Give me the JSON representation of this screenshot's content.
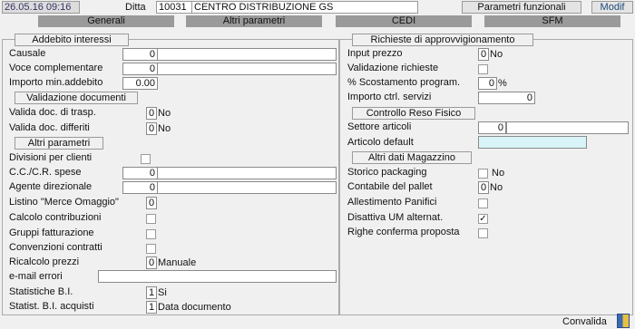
{
  "header": {
    "datetime": "26.05.16 09:16",
    "ditta_label": "Ditta",
    "ditta_code": "10031",
    "ditta_name": "CENTRO DISTRIBUZIONE GS",
    "parametri_button": "Parametri funzionali",
    "modif_label": "Modif"
  },
  "tabs": [
    "Generali",
    "Altri parametri",
    "CEDI",
    "SFM"
  ],
  "left": {
    "addebito": {
      "title": "Addebito interessi",
      "causale_label": "Causale",
      "causale_value": "0",
      "voce_label": "Voce complementare",
      "voce_value": "0",
      "importo_label": "Importo min.addebito",
      "importo_value": "0.00"
    },
    "validazione": {
      "title": "Validazione documenti",
      "trasp_label": "Valida doc. di trasp.",
      "trasp_value": "0",
      "trasp_text": "No",
      "diff_label": "Valida doc. differiti",
      "diff_value": "0",
      "diff_text": "No"
    },
    "altri": {
      "title": "Altri parametri",
      "divisioni_label": "Divisioni per clienti",
      "cc_label": "C.C./C.R. spese",
      "cc_value": "0",
      "agente_label": "Agente  direzionale",
      "agente_value": "0",
      "listino_label": "Listino \"Merce Omaggio\"",
      "listino_value": "0",
      "calcolo_label": "Calcolo contribuzioni",
      "gruppi_label": "Gruppi  fatturazione",
      "convenzioni_label": "Convenzioni contratti",
      "ricalcolo_label": "Ricalcolo prezzi",
      "ricalcolo_value": "0",
      "ricalcolo_text": "Manuale",
      "email_label": "e-mail errori",
      "statistiche_label": "Statistiche B.I.",
      "statistiche_value": "1",
      "statistiche_text": "Si",
      "statist_label": "Statist. B.I. acquisti",
      "statist_value": "1",
      "statist_text": "Data documento"
    }
  },
  "right": {
    "richieste": {
      "title": "Richieste di approvvigionamento",
      "input_label": "Input prezzo",
      "input_value": "0",
      "input_text": "No",
      "valid_label": "Validazione richieste",
      "scost_label": "% Scostamento program.",
      "scost_value": "0",
      "scost_unit": "%",
      "importo_label": "Importo ctrl. servizi",
      "importo_value": "0"
    },
    "reso": {
      "title": "Controllo Reso Fisico",
      "settore_label": "Settore articoli",
      "settore_value": "0",
      "articolo_label": "Articolo default"
    },
    "magazzino": {
      "title": "Altri dati Magazzino",
      "storico_label": "Storico packaging",
      "storico_text": "No",
      "contabile_label": "Contabile del pallet",
      "contabile_value": "0",
      "contabile_text": "No",
      "allestimento_label": "Allestimento Panifici",
      "disattiva_label": "Disattiva UM alternat.",
      "disattiva_check": "✓",
      "righe_label": "Righe conferma proposta"
    }
  },
  "footer": {
    "convalida_label": "Convalida"
  }
}
